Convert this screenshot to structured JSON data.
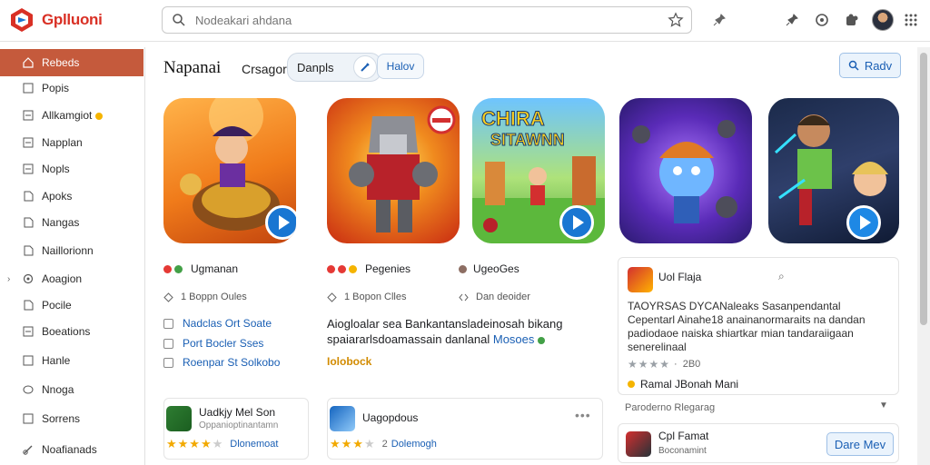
{
  "app": {
    "logo_text": "Gplluoni",
    "brand_color": "#d93025",
    "accent_color": "#c55a3c",
    "link_color": "#1a5fb4"
  },
  "search": {
    "placeholder": "Nodeakari ahdana",
    "value": ""
  },
  "toolbar_icons": [
    "pin-icon",
    "pin-icon",
    "info-icon",
    "puzzle-icon",
    "avatar",
    "apps-grid-icon"
  ],
  "sidebar": {
    "items": [
      {
        "label": "Rebeds",
        "icon": "home-icon",
        "active": true
      },
      {
        "label": "Popis",
        "icon": "page-icon"
      },
      {
        "label": "Allkamgiot",
        "icon": "tag-icon",
        "coin": true
      },
      {
        "label": "Napplan",
        "icon": "list-icon"
      },
      {
        "label": "Nopls",
        "icon": "list-icon"
      },
      {
        "label": "Apoks",
        "icon": "page-icon"
      },
      {
        "label": "Nangas",
        "icon": "page-icon"
      },
      {
        "label": "Naillorionn",
        "icon": "page-icon"
      },
      {
        "label": "Aoagion",
        "icon": "gear-icon",
        "expandable": true
      },
      {
        "label": "Pocile",
        "icon": "page-icon"
      },
      {
        "label": "Boeations",
        "icon": "list-icon"
      },
      {
        "label": "Hanle",
        "icon": "list-icon"
      },
      {
        "label": "Nnoga",
        "icon": "circle-icon"
      },
      {
        "label": "Sorrens",
        "icon": "list-icon"
      },
      {
        "label": "Noafianads",
        "icon": "link-icon"
      }
    ]
  },
  "header": {
    "title": "Napanai",
    "sub_tab": "Crsagor",
    "pill_label": "Danpls",
    "ghost_button": "Halov",
    "ready_button": "Radv"
  },
  "games": [
    {
      "icon_name": "game-art-pirate",
      "has_play": true
    },
    {
      "icon_name": "game-art-robot",
      "has_play": false
    },
    {
      "icon_name": "game-art-jungle",
      "has_play": true,
      "art_text_1": "CHIRA",
      "art_text_2": "SITAWNN"
    },
    {
      "icon_name": "game-art-hero",
      "has_play": false
    },
    {
      "icon_name": "game-art-kids",
      "has_play": true
    }
  ],
  "column1": {
    "title": "Ugmanan",
    "meta": "1 Boppn  Oules",
    "links": [
      "Nadclas Ort Soate",
      "Port Bocler Sses",
      "Roenpar St Solkobo"
    ]
  },
  "column2": {
    "title": "Pegenies",
    "meta": "1 Bopon  Clles",
    "desc_line1": "Aiogloalar sea Bankantansladeinosah bikang",
    "desc_line2": "spaiararlsdoamassain danlanal",
    "desc_highlight": "Mosoes",
    "tag": "Iolobock"
  },
  "column3": {
    "title": "UgeoGes",
    "meta": "Dan deoider"
  },
  "review": {
    "name": "Uol Flaja",
    "title_line1": "TAOYRSAS DYCANaleaks Sasanpendantal",
    "title_line2": "Cepentarl Ainahe18 anainanormaraits na dandan",
    "title_line3": "padiodaoe naiska shiartkar mian tandaraiigaan",
    "title_line4": "senerelinaal",
    "rating_count": "2B0",
    "footer": "Ramal JBonah Mani",
    "caption": "Paroderno Rlegarag"
  },
  "bottom": [
    {
      "title": "Uadkjy Mel Son",
      "subtitle": "Oppanioptinantamn",
      "rating": "Dlonemoat"
    },
    {
      "title": "Uagopdous",
      "rating": "Dolemogh",
      "rating_num": "2"
    },
    {
      "title": "Cpl Famat",
      "subtitle": "Boconamint",
      "button": "Dare Mev"
    }
  ]
}
